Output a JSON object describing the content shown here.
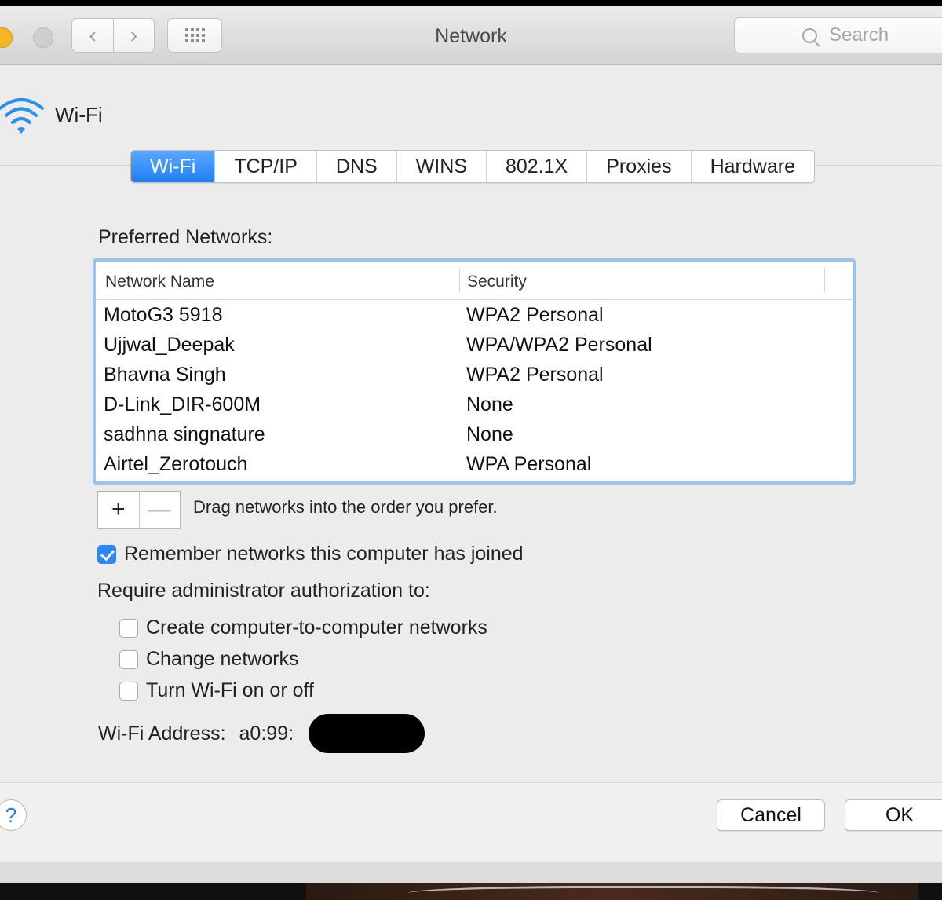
{
  "window": {
    "title": "Network",
    "search_placeholder": "Search"
  },
  "interface": {
    "name": "Wi-Fi",
    "icon": "wifi-icon"
  },
  "tabs": [
    {
      "label": "Wi-Fi",
      "active": true
    },
    {
      "label": "TCP/IP",
      "active": false
    },
    {
      "label": "DNS",
      "active": false
    },
    {
      "label": "WINS",
      "active": false
    },
    {
      "label": "802.1X",
      "active": false
    },
    {
      "label": "Proxies",
      "active": false
    },
    {
      "label": "Hardware",
      "active": false
    }
  ],
  "preferred": {
    "label": "Preferred Networks:",
    "columns": {
      "name": "Network Name",
      "security": "Security"
    },
    "rows": [
      {
        "name": "MotoG3 5918",
        "security": "WPA2 Personal"
      },
      {
        "name": "Ujjwal_Deepak",
        "security": "WPA/WPA2 Personal"
      },
      {
        "name": "Bhavna Singh",
        "security": "WPA2 Personal"
      },
      {
        "name": "D-Link_DIR-600M",
        "security": "None"
      },
      {
        "name": "sadhna singnature",
        "security": "None"
      },
      {
        "name": "Airtel_Zerotouch",
        "security": "WPA Personal"
      }
    ],
    "add_label": "+",
    "remove_label": "—",
    "drag_hint": "Drag networks into the order you prefer."
  },
  "options": {
    "remember": {
      "label": "Remember networks this computer has joined",
      "checked": true
    },
    "require_label": "Require administrator authorization to:",
    "admin": [
      {
        "label": "Create computer-to-computer networks",
        "checked": false
      },
      {
        "label": "Change networks",
        "checked": false
      },
      {
        "label": "Turn Wi-Fi on or off",
        "checked": false
      }
    ]
  },
  "address": {
    "label": "Wi-Fi Address:",
    "value": "a0:99:"
  },
  "footer": {
    "help_label": "?",
    "cancel_label": "Cancel",
    "ok_label": "OK"
  },
  "colors": {
    "accent": "#2a87f4",
    "list_focus": "#9ac3f2"
  }
}
